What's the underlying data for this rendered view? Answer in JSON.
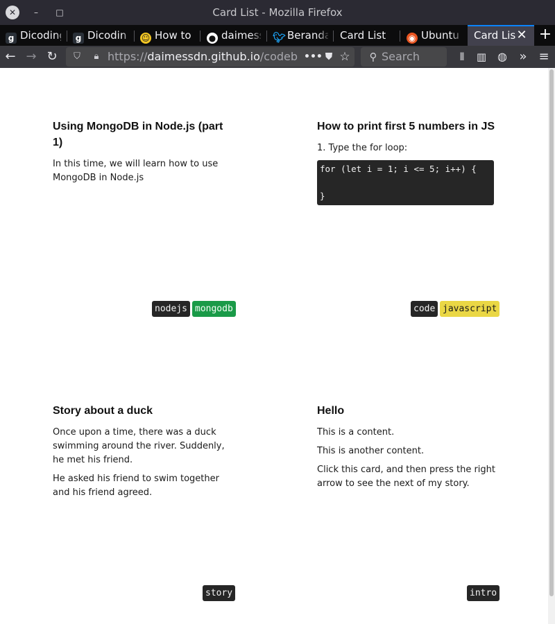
{
  "window": {
    "title": "Card List - Mozilla Firefox"
  },
  "tabs": [
    {
      "label": "Dicoding",
      "icon": "dicoding-icon"
    },
    {
      "label": "Dicoding",
      "icon": "dicoding-icon"
    },
    {
      "label": "How to",
      "icon": "ninja-icon"
    },
    {
      "label": "daimess",
      "icon": "github-icon"
    },
    {
      "label": "Beranda",
      "icon": "twitter-icon"
    },
    {
      "label": "Card List",
      "icon": ""
    },
    {
      "label": "Ubuntu",
      "icon": "ubuntu-icon"
    },
    {
      "label": "Card List",
      "icon": "",
      "active": true
    }
  ],
  "navbar": {
    "url_prefix": "https://",
    "url_host": "daimessdn.github.io",
    "url_path": "/codebreak",
    "search_placeholder": "Search"
  },
  "cards": [
    {
      "title": "Using MongoDB in Node.js (part 1)",
      "paragraphs": [
        "In this time, we will learn how to use MongoDB in Node.js"
      ],
      "tags": [
        "nodejs",
        "mongodb"
      ]
    },
    {
      "title": "How to print first 5 numbers in JS",
      "paragraphs": [
        "1. Type the for loop:"
      ],
      "code": "for (let i = 1; i <= 5; i++) {\n\n}",
      "tags": [
        "code",
        "javascript"
      ]
    },
    {
      "title": "Story about a duck",
      "paragraphs": [
        "Once upon a time, there was a duck swimming around the river. Suddenly, he met his friend.",
        "He asked his friend to swim together and his friend agreed."
      ],
      "tags": [
        "story"
      ]
    },
    {
      "title": "Hello",
      "paragraphs": [
        "This is a content.",
        "This is another content.",
        "Click this card, and then press the right arrow to see the next of my story."
      ],
      "tags": [
        "intro"
      ]
    }
  ],
  "colors": {
    "tag_dark": "#262626",
    "tag_green": "#1a9a48",
    "tag_yellow": "#ead745",
    "active_tab_accent": "#0a84ff"
  }
}
